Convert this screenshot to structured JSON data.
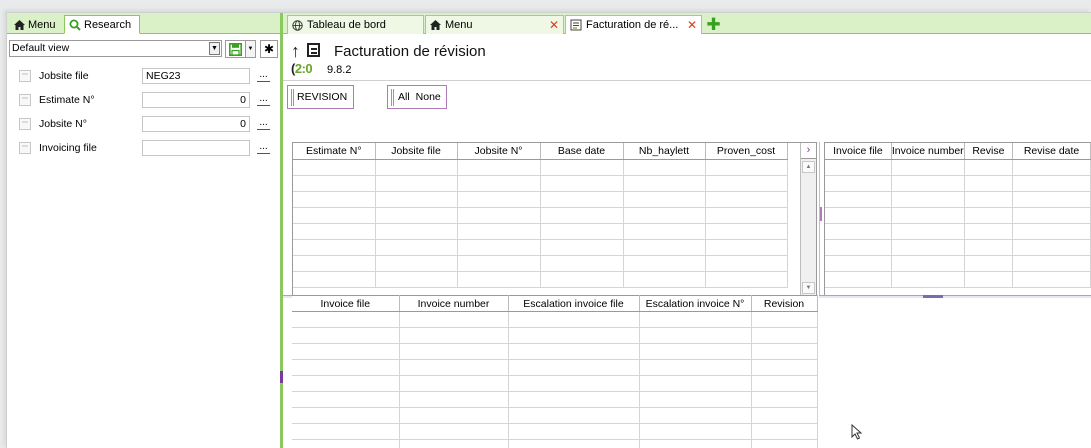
{
  "left_panel": {
    "tabs": [
      {
        "label": "Menu",
        "icon": "home-icon"
      },
      {
        "label": "Research",
        "icon": "search-icon"
      }
    ],
    "view_select": {
      "value": "Default view"
    },
    "fields": [
      {
        "label": "Jobsite file",
        "value": "NEG23",
        "align": "left"
      },
      {
        "label": "Estimate N°",
        "value": "0",
        "align": "right"
      },
      {
        "label": "Jobsite N°",
        "value": "0",
        "align": "right"
      },
      {
        "label": "Invoicing file",
        "value": "",
        "align": "left"
      }
    ],
    "browse_label": "..."
  },
  "tabs": [
    {
      "label": "Tableau de bord",
      "icon": "globe-icon",
      "closable": false
    },
    {
      "label": "Menu",
      "icon": "home-icon",
      "closable": true
    },
    {
      "label": "Facturation de ré...",
      "icon": "invoice-icon",
      "closable": true
    }
  ],
  "header": {
    "logo_text": "2:0",
    "title": "Facturation de révision",
    "version": "9.8.2"
  },
  "filters": {
    "revision_label": "REVISION",
    "all_label": "All",
    "none_label": "None"
  },
  "grid_estimates": {
    "columns": [
      "Estimate N°",
      "Jobsite file",
      "Jobsite N°",
      "Base date",
      "Nb_haylett",
      "Proven_cost"
    ],
    "rows": 8
  },
  "grid_invoices": {
    "columns": [
      "Invoice file",
      "Invoice number",
      "Revise",
      "Revise date"
    ],
    "rows": 8
  },
  "grid_escalation": {
    "columns": [
      "Invoice file",
      "Invoice number",
      "Escalation invoice file",
      "Escalation invoice N°",
      "Revision"
    ],
    "rows": 9
  },
  "colors": {
    "accent_green": "#8cc860",
    "tab_bg": "#daf0c6",
    "close_red": "#e03a1a",
    "purple": "#b07ab8"
  }
}
